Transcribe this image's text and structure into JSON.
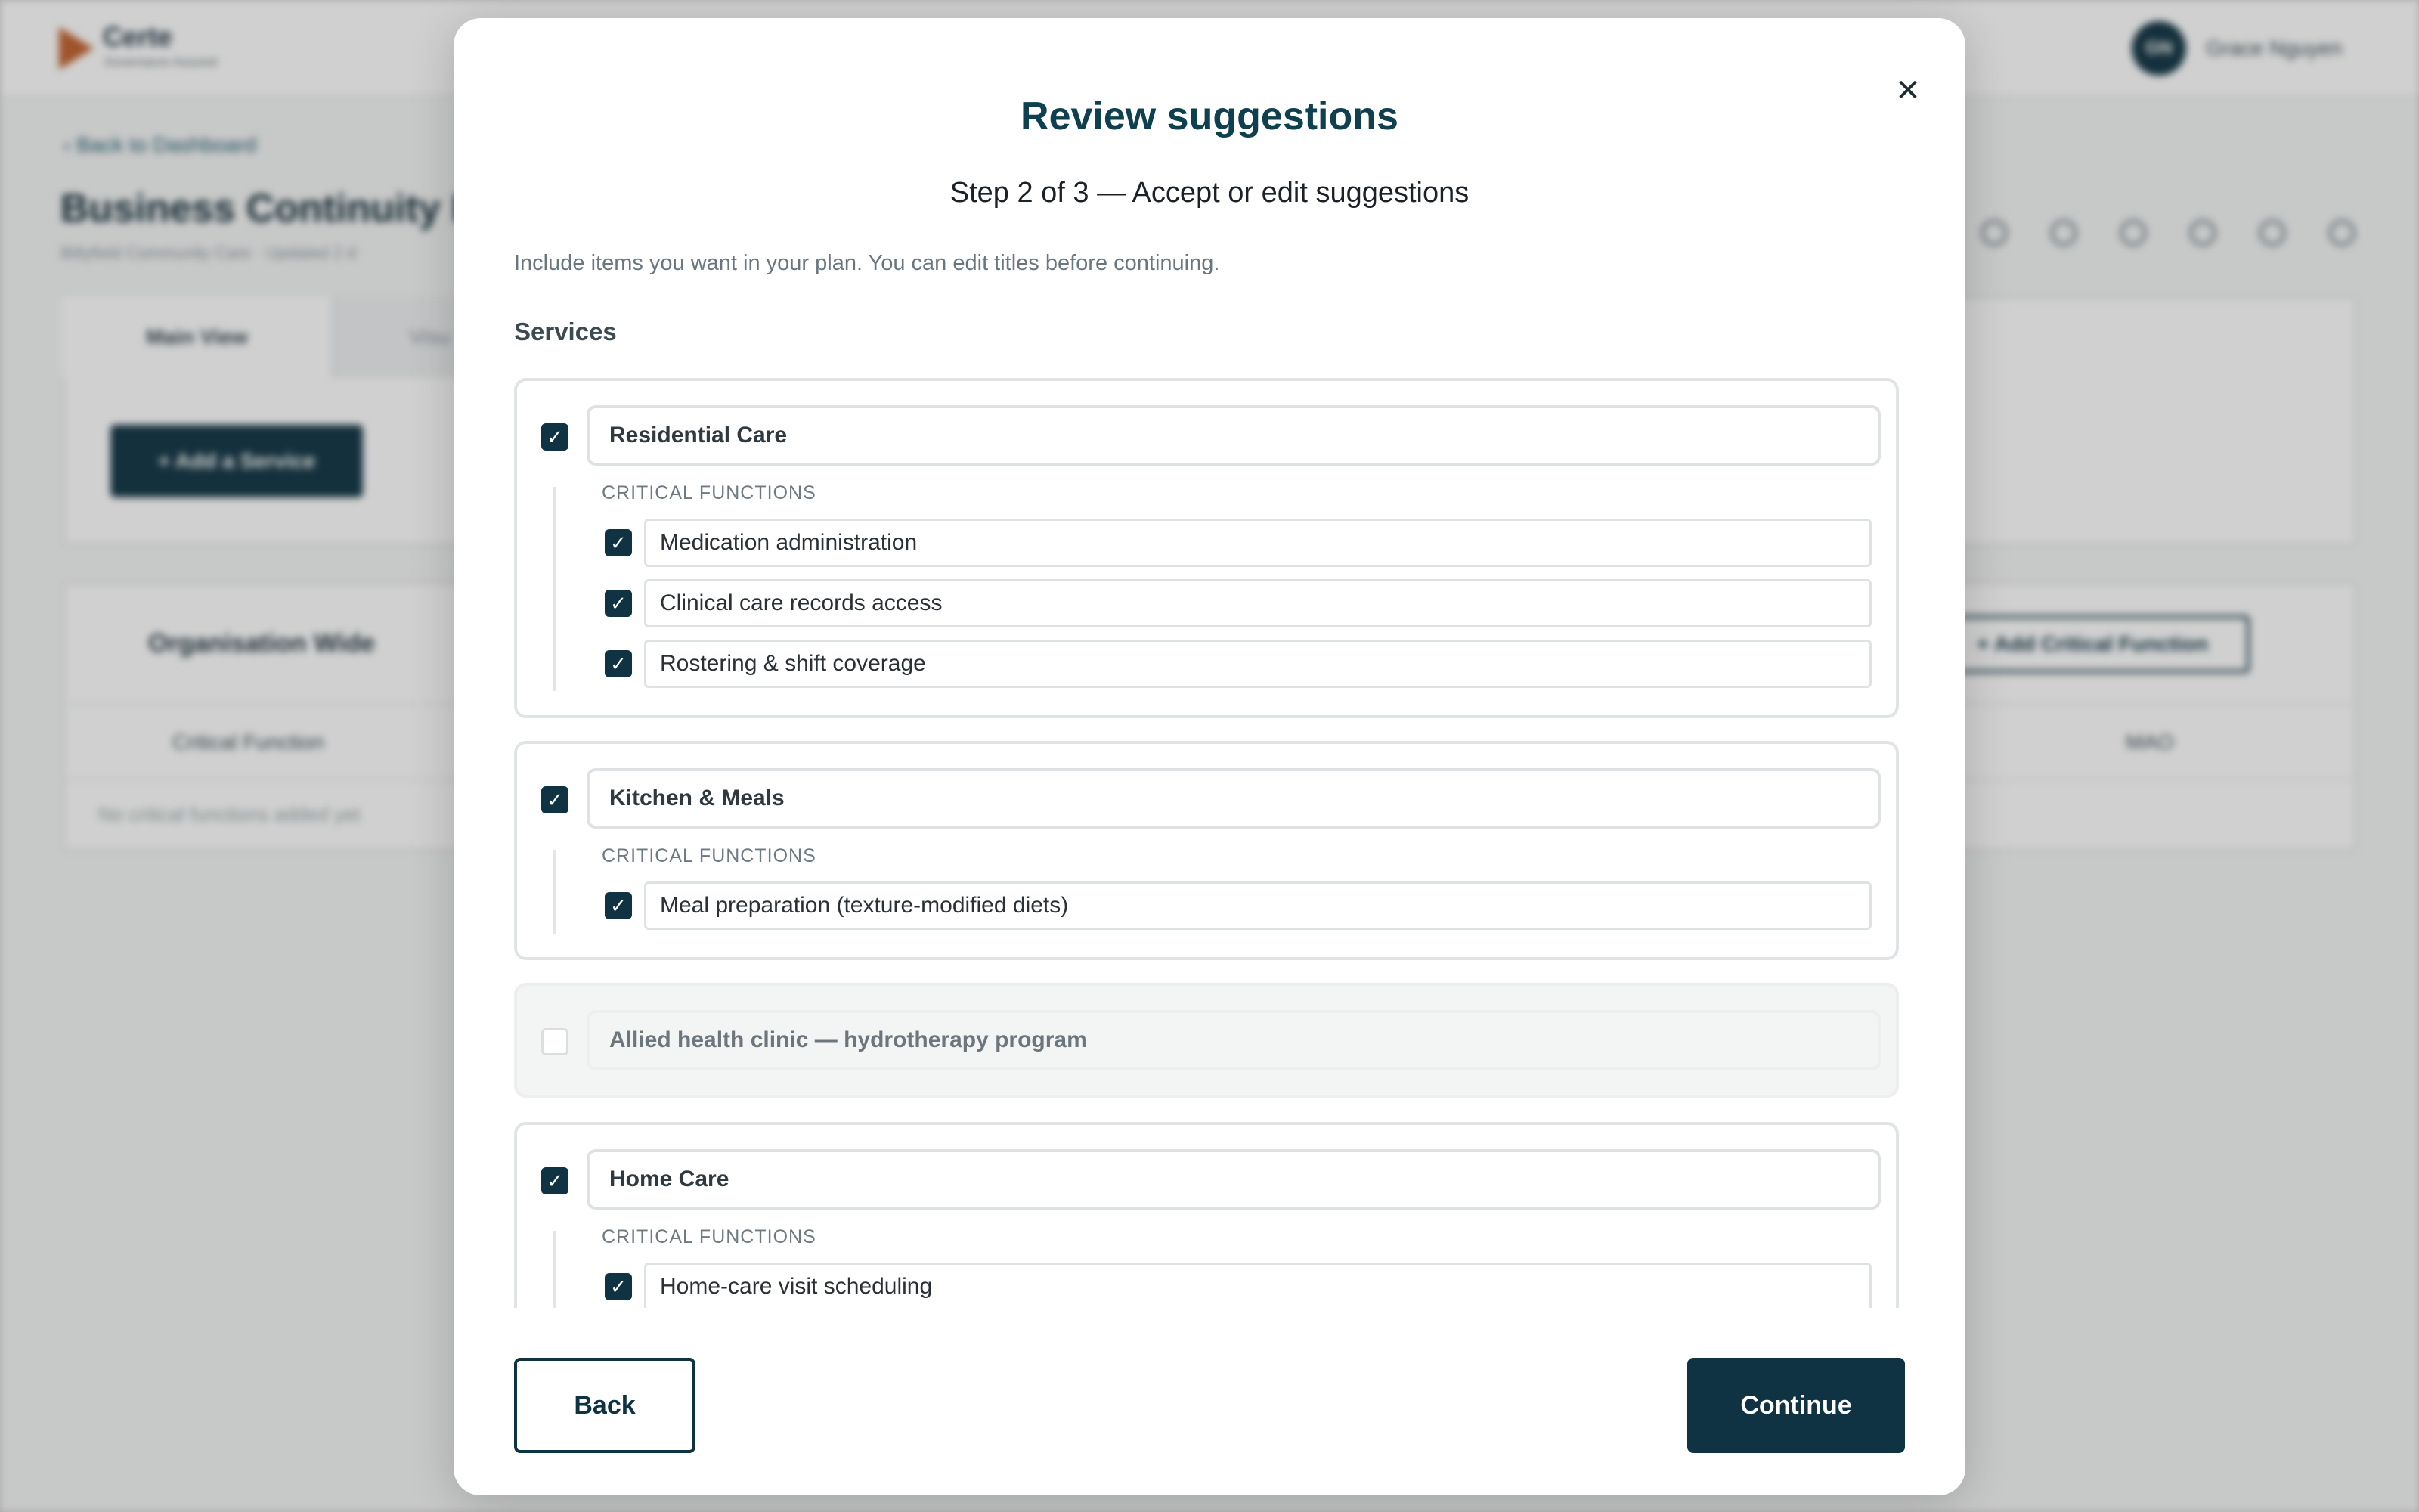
{
  "background": {
    "brand": {
      "name": "Certe",
      "tagline": "Governance Assured"
    },
    "user": {
      "initials": "GN",
      "name": "Grace Nguyen"
    },
    "back_link": "Back to Dashboard",
    "title": "Business Continuity P",
    "subtitle": "Billyfield Community Care · Updated 2 d",
    "tabs": {
      "main": "Main View",
      "other": "Visu"
    },
    "add_service": "+ Add a Service",
    "group_name": "Organisation Wide",
    "add_critical_function": "+ Add Critical Function",
    "columns": {
      "critical_function": "Critical Function",
      "mao": "MAO"
    },
    "empty_note": "No critical functions added yet"
  },
  "modal": {
    "title": "Review suggestions",
    "step": "Step 2 of 3 — Accept or edit suggestions",
    "intro": "Include items you want in your plan. You can edit titles before continuing.",
    "section_label": "Services",
    "cf_label": "CRITICAL FUNCTIONS",
    "services": [
      {
        "name": "Residential Care",
        "checked": true,
        "functions": [
          {
            "name": "Medication administration",
            "checked": true
          },
          {
            "name": "Clinical care records access",
            "checked": true
          },
          {
            "name": "Rostering & shift coverage",
            "checked": true
          }
        ]
      },
      {
        "name": "Kitchen & Meals",
        "checked": true,
        "functions": [
          {
            "name": "Meal preparation (texture-modified diets)",
            "checked": true
          }
        ]
      },
      {
        "name": "Allied health clinic — hydrotherapy program",
        "checked": false,
        "functions": []
      },
      {
        "name": "Home Care",
        "checked": true,
        "functions": [
          {
            "name": "Home-care visit scheduling",
            "checked": true
          }
        ]
      }
    ],
    "back_label": "Back",
    "continue_label": "Continue"
  },
  "colors": {
    "primary": "#0f3342",
    "title": "#0e4050",
    "border": "#e1e4e6",
    "disabled_bg": "#f3f4f4"
  }
}
